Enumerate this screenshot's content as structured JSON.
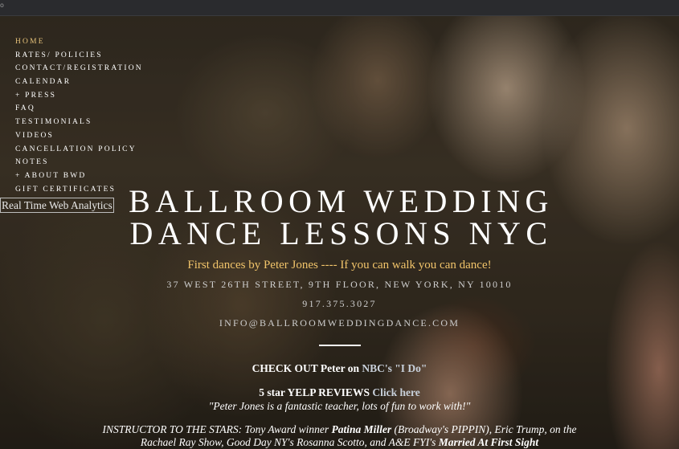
{
  "topbar": {
    "corner_text": "o"
  },
  "nav": {
    "items": [
      {
        "label": "HOME"
      },
      {
        "label": "RATES/ POLICIES"
      },
      {
        "label": "CONTACT/REGISTRATION"
      },
      {
        "label": "CALENDAR"
      },
      {
        "label": "+ PRESS"
      },
      {
        "label": "FAQ"
      },
      {
        "label": "TESTIMONIALS"
      },
      {
        "label": "VIDEOS"
      },
      {
        "label": "CANCELLATION POLICY"
      },
      {
        "label": "NOTES"
      },
      {
        "label": "+ ABOUT BWD"
      },
      {
        "label": "GIFT CERTIFICATES"
      }
    ],
    "active_index": 0
  },
  "analytics_badge": "Real Time Web Analytics",
  "hero": {
    "title_line1": "BALLROOM WEDDING",
    "title_line2": "DANCE LESSONS NYC",
    "tagline": "First dances by Peter Jones ---- If you can walk you can dance!",
    "address": "37 WEST 26TH STREET, 9TH FLOOR, NEW YORK, NY 10010",
    "phone": "917.375.3027",
    "email": "INFO@BALLROOMWEDDINGDANCE.COM"
  },
  "content": {
    "checkout_prefix": "CHECK OUT Peter on ",
    "checkout_link": "NBC's \"I Do\"",
    "yelp_prefix": "5 star YELP REVIEWS ",
    "yelp_link": "Click here",
    "quote": "\"Peter Jones is a fantastic teacher, lots of fun to work with!\"",
    "stars_a": "INSTRUCTOR TO THE STARS:  Tony Award winner ",
    "stars_b": "Patina Miller",
    "stars_c": " (Broadway's PIPPIN), Eric Trump, on the",
    "stars_d": "Rachael Ray Show, Good Day NY's Rosanna Scotto, and A&E FYI's  ",
    "stars_e": "Married At First Sight"
  },
  "colors": {
    "accent_gold": "#f1c46a",
    "nav_active": "#e6c27a",
    "text": "#ffffff"
  }
}
